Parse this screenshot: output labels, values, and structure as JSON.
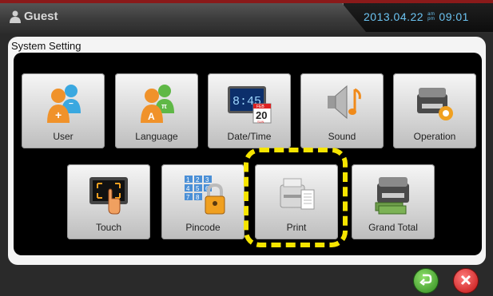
{
  "header": {
    "user_label": "Guest",
    "date": "2013.04.22",
    "ampm_top": "am",
    "ampm_bottom": "pm",
    "time": "09:01"
  },
  "panel": {
    "title": "System Setting"
  },
  "buttons": [
    {
      "label": "User",
      "icon": "user-icon"
    },
    {
      "label": "Language",
      "icon": "language-icon"
    },
    {
      "label": "Date/Time",
      "icon": "date-time-icon",
      "icon_text_clock": "8:45",
      "icon_text_cal_month": "FEB",
      "icon_text_cal_day": "20",
      "icon_text_cal_weekday": "SUN"
    },
    {
      "label": "Sound",
      "icon": "sound-icon"
    },
    {
      "label": "Operation",
      "icon": "operation-icon"
    },
    {
      "label": "Touch",
      "icon": "touch-icon"
    },
    {
      "label": "Pincode",
      "icon": "pincode-icon",
      "keys": [
        "1",
        "2",
        "3",
        "4",
        "5",
        "6",
        "7",
        "8"
      ]
    },
    {
      "label": "Print",
      "icon": "print-icon"
    },
    {
      "label": "Grand Total",
      "icon": "grand-total-icon"
    }
  ],
  "colors": {
    "clock": "#6cc4f2",
    "highlight": "#f5e400",
    "ok": "#2f8a1e",
    "cancel": "#c01010"
  }
}
